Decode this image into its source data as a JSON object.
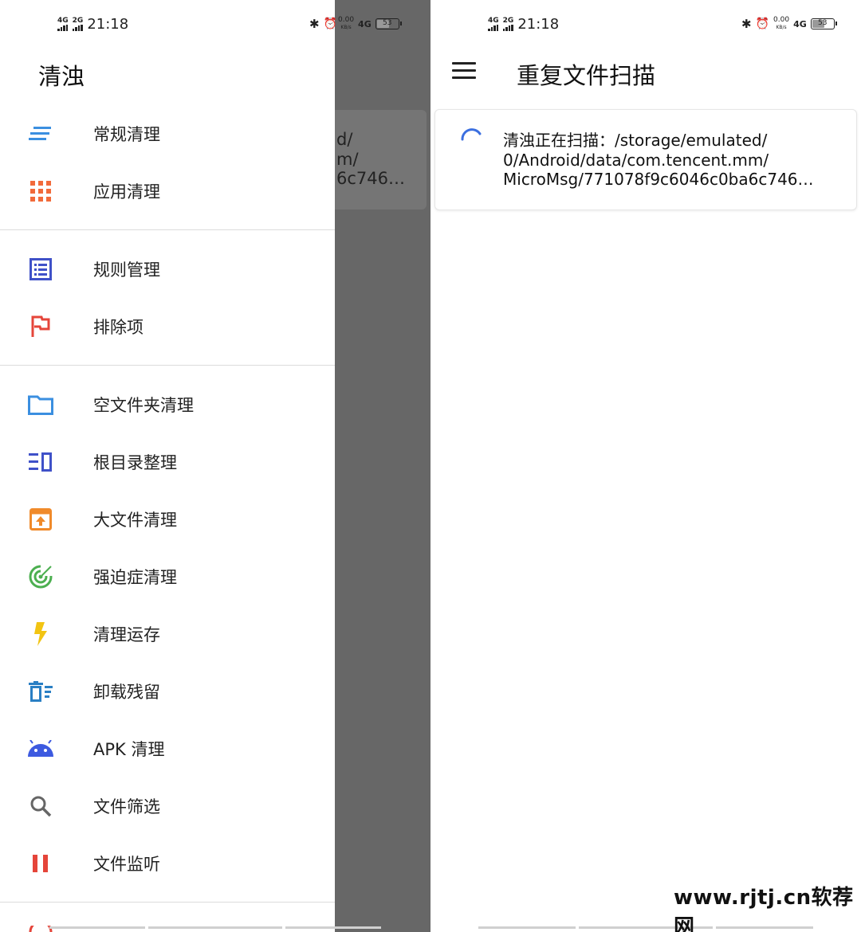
{
  "status_bar": {
    "time": "21:18",
    "net1": "4G",
    "net2": "2G",
    "speed_value": "0.00",
    "speed_unit": "KB/s",
    "net_right": "4G",
    "battery": "53"
  },
  "drawer": {
    "title": "清浊",
    "items": [
      {
        "label": "常规清理",
        "icon": "lines-icon",
        "color": "#3b8fe0"
      },
      {
        "label": "应用清理",
        "icon": "grid-apps-icon",
        "color": "#f26a3a"
      },
      {
        "label": "规则管理",
        "icon": "list-doc-icon",
        "color": "#3f51c8"
      },
      {
        "label": "排除项",
        "icon": "flag-icon",
        "color": "#e5453a"
      },
      {
        "label": "空文件夹清理",
        "icon": "folder-icon",
        "color": "#3b8fe0"
      },
      {
        "label": "根目录整理",
        "icon": "root-list-icon",
        "color": "#3f51c8"
      },
      {
        "label": "大文件清理",
        "icon": "upload-box-icon",
        "color": "#f08a2a"
      },
      {
        "label": "强迫症清理",
        "icon": "target-icon",
        "color": "#4caf50"
      },
      {
        "label": "清理运存",
        "icon": "lightning-icon",
        "color": "#f2c412"
      },
      {
        "label": "卸载残留",
        "icon": "trash-list-icon",
        "color": "#2a7fc4"
      },
      {
        "label": "APK 清理",
        "icon": "android-icon",
        "color": "#3d5ae0"
      },
      {
        "label": "文件筛选",
        "icon": "search-icon",
        "color": "#666666"
      },
      {
        "label": "文件监听",
        "icon": "pause-icon",
        "color": "#e5453a"
      }
    ]
  },
  "main": {
    "title": "重复文件扫描",
    "scan_text": "清浊正在扫描：/storage/emulated/\n0/Android/data/com.tencent.mm/\nMicroMsg/771078f9c6046c0ba6c746…",
    "scrim_text": "d/\nm/\n6c746…",
    "spinner_color": "#3b6fe0"
  },
  "watermark": "www.rjtj.cn软荐网"
}
